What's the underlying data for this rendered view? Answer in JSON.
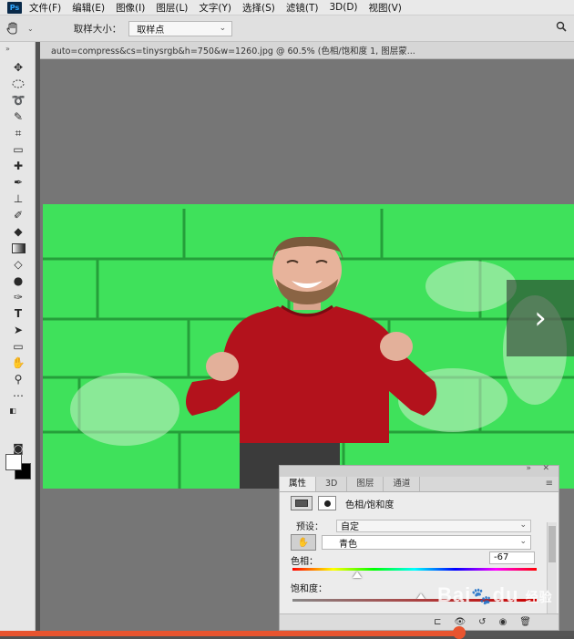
{
  "menubar": {
    "app_icon": "Ps",
    "items": [
      "文件(F)",
      "编辑(E)",
      "图像(I)",
      "图层(L)",
      "文字(Y)",
      "选择(S)",
      "滤镜(T)",
      "3D(D)",
      "视图(V)"
    ]
  },
  "options_bar": {
    "sample_size_label": "取样大小：",
    "sample_size_value": "取样点"
  },
  "document": {
    "tab_title": "auto=compress&cs=tinysrgb&h=750&w=1260.jpg @ 60.5% (色相/饱和度 1, 图层蒙..."
  },
  "tools": [
    "move-tool",
    "marquee-tool",
    "lasso-tool",
    "quick-select-tool",
    "crop-tool",
    "eyedropper-tool",
    "healing-tool",
    "brush-tool",
    "stamp-tool",
    "history-brush-tool",
    "eraser-tool",
    "gradient-tool",
    "blur-tool",
    "dodge-tool",
    "pen-tool",
    "type-tool",
    "path-select-tool",
    "rectangle-tool",
    "hand-tool",
    "zoom-tool",
    "more-tools"
  ],
  "properties_panel": {
    "tabs": [
      "属性",
      "3D",
      "图层",
      "通道"
    ],
    "active_tab": "属性",
    "title": "色相/饱和度",
    "preset_label": "预设：",
    "preset_value": "自定",
    "channel_value": "青色",
    "hue_label": "色相：",
    "hue_value": "-67",
    "hue_value_fraction": 0.31,
    "saturation_label": "饱和度："
  },
  "watermark": {
    "brand": "Bai",
    "du": "du",
    "suffix": "经验"
  },
  "colors": {
    "canvas_green": "#3fe15b",
    "sweater": "#b3121c",
    "progress": "#e8542f"
  },
  "video_progress": 0.8
}
